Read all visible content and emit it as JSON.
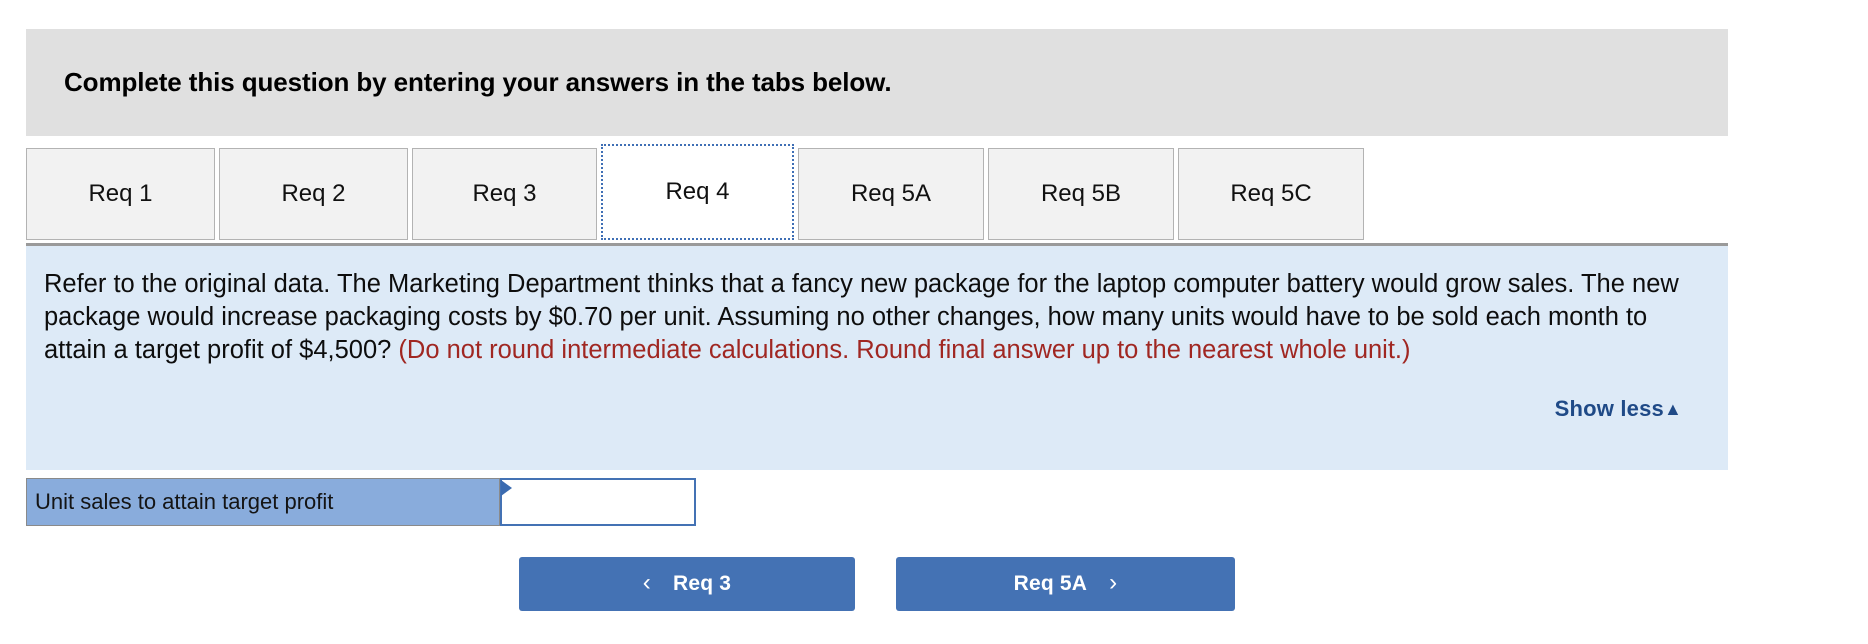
{
  "banner": {
    "text": "Complete this question by entering your answers in the tabs below."
  },
  "tabs": {
    "items": [
      {
        "label": "Req 1",
        "active": false
      },
      {
        "label": "Req 2",
        "active": false
      },
      {
        "label": "Req 3",
        "active": false
      },
      {
        "label": "Req 4",
        "active": true
      },
      {
        "label": "Req 5A",
        "active": false
      },
      {
        "label": "Req 5B",
        "active": false
      },
      {
        "label": "Req 5C",
        "active": false
      }
    ]
  },
  "question": {
    "body": "Refer to the original data. The Marketing Department thinks that a fancy new package for the laptop computer battery would grow sales. The new package would increase packaging costs by $0.70 per unit. Assuming no other changes, how many units would have to be sold each month to attain a target profit of $4,500? ",
    "hint": "(Do not round intermediate calculations. Round final answer up to the nearest whole unit.)",
    "show_less_label": "Show less",
    "show_less_caret": "▲"
  },
  "answer": {
    "row_label": "Unit sales to attain target profit",
    "value": "",
    "placeholder": ""
  },
  "navigation": {
    "prev_label": "Req 3",
    "prev_chevron": "‹",
    "next_label": "Req 5A",
    "next_chevron": "›"
  },
  "colors": {
    "banner_bg": "#e0e0e0",
    "panel_bg": "#ddeaf7",
    "tab_bg": "#f2f2f2",
    "active_tab_border": "#3f6fb5",
    "hint_red": "#a02722",
    "label_cell_blue": "#89acdc",
    "button_blue": "#4472b4",
    "link_blue": "#1f4a87"
  }
}
